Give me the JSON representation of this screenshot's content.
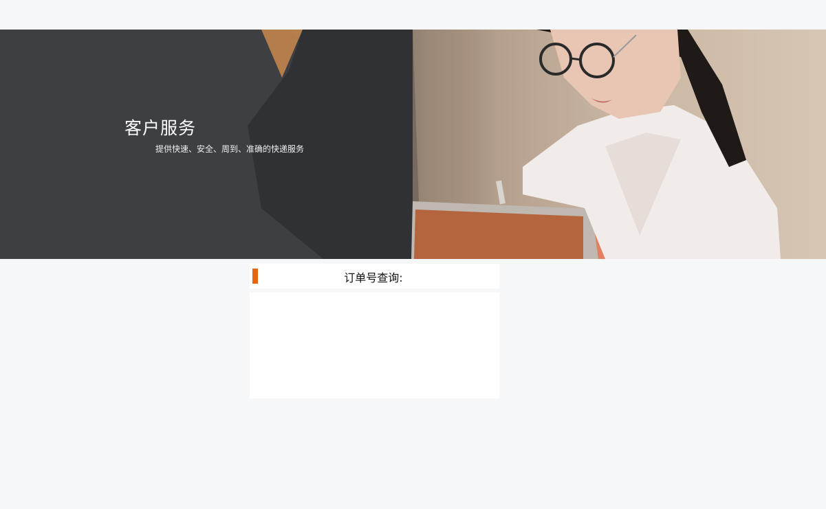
{
  "banner": {
    "title": "客户服务",
    "subtitle": "提供快速、安全、周到、准确的快递服务"
  },
  "query": {
    "title": "订单号查询:",
    "result": ""
  },
  "colors": {
    "accent": "#e8650a",
    "page_background": "#f6f7f9",
    "panel_background": "#ffffff"
  }
}
